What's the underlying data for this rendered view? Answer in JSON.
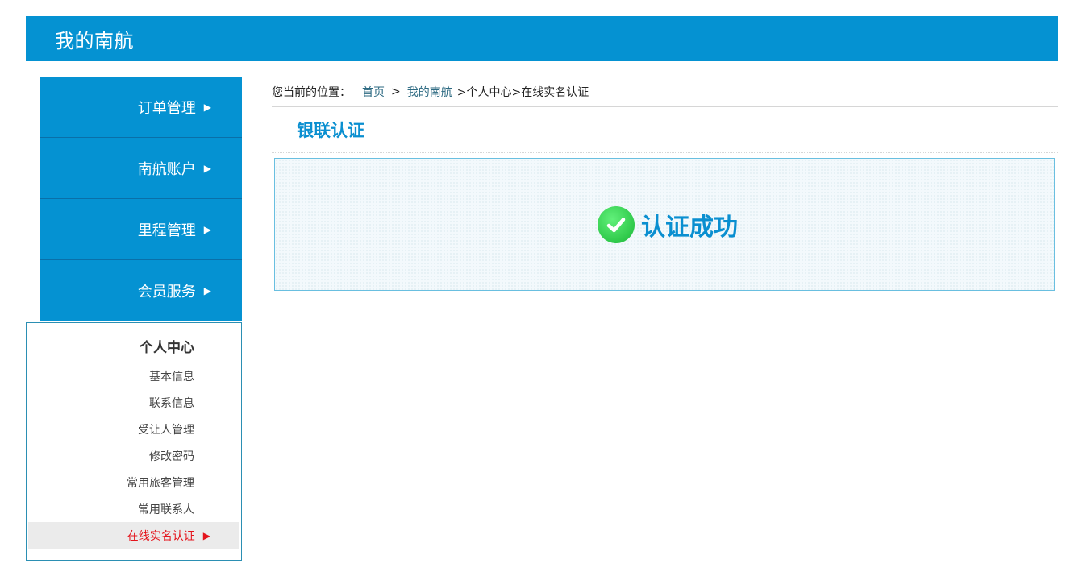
{
  "header": {
    "title": "我的南航"
  },
  "sidebar": {
    "items": [
      {
        "label": "订单管理"
      },
      {
        "label": "南航账户"
      },
      {
        "label": "里程管理"
      },
      {
        "label": "会员服务"
      }
    ],
    "arrow": "▶"
  },
  "personal_center": {
    "heading": "个人中心",
    "items": [
      {
        "label": "基本信息"
      },
      {
        "label": "联系信息"
      },
      {
        "label": "受让人管理"
      },
      {
        "label": "修改密码"
      },
      {
        "label": "常用旅客管理"
      },
      {
        "label": "常用联系人"
      },
      {
        "label": "在线实名认证",
        "active": true
      }
    ],
    "active_arrow": "▶"
  },
  "breadcrumb": {
    "prefix": "您当前的位置：",
    "home": "首页",
    "sep": ">",
    "my": "我的南航",
    "rest": ">个人中心>在线实名认证"
  },
  "section": {
    "title": "银联认证"
  },
  "result": {
    "text": "认证成功",
    "icon": "check-circle-icon"
  },
  "colors": {
    "primary": "#0592d2",
    "active_text": "#e4141c",
    "success_green": "#2fc94a"
  }
}
